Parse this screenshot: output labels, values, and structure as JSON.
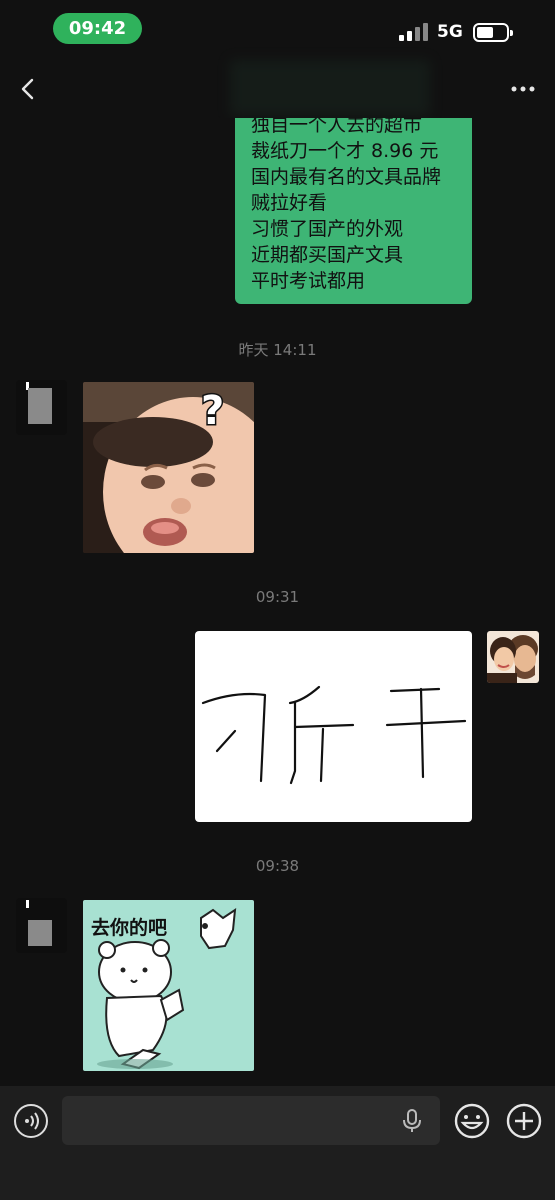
{
  "status_bar": {
    "time": "09:42",
    "network": "5G"
  },
  "nav": {
    "back_icon": "chevron-left-icon",
    "more_icon": "more-dots-icon"
  },
  "messages": {
    "first_bubble_lines": [
      "独自一个人去的超市",
      "裁纸刀一个才 8.96 元",
      "国内最有名的文具品牌",
      "贼拉好看",
      "习惯了国产的外观",
      "近期都买国产文具",
      "平时考试都用"
    ],
    "stamp_1": "昨天 14:11",
    "stamp_2": "09:31",
    "stamp_3": "09:38",
    "sticker_bear_text": "去你的吧",
    "sticker_baby_mark": "?",
    "drawing_text": "刁斤干"
  },
  "input_bar": {
    "text_value": ""
  },
  "colors": {
    "accent": "#3eb575",
    "time_pill": "#2fb25c",
    "background": "#111111"
  }
}
